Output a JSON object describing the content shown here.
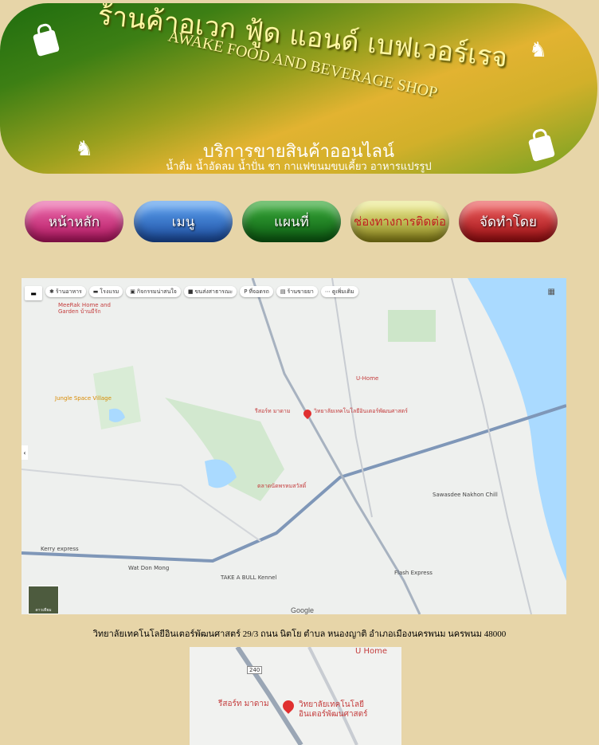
{
  "banner": {
    "title_th": "ร้านค้าอเวก ฟู้ด แอนด์ เบฟเวอร์เรจ",
    "title_en": "AWAKE FOOD AND BEVERAGE SHOP",
    "service": "บริการขายสินค้าออนไลน์",
    "products": "น้ำดื่ม น้ำอัดลม น้ำปั่น ชา กาแฟขนมขบเคี้ยว อาหารแปรรูป"
  },
  "nav": {
    "home": "หน้าหลัก",
    "menu": "เมนู",
    "map": "แผนที่",
    "contact": "ช่องทางการติดต่อ",
    "made_by": "จัดทำโดย"
  },
  "map": {
    "toolbar": [
      {
        "icon": "restaurant-icon",
        "label": "ร้านอาหาร"
      },
      {
        "icon": "hotel-icon",
        "label": "โรงแรม"
      },
      {
        "icon": "camera-icon",
        "label": "กิจกรรมน่าสนใจ"
      },
      {
        "icon": "pharmacy-icon",
        "label": "ขนส่งสาธารณะ"
      },
      {
        "icon": "parking-icon",
        "label": "ที่จอดรถ"
      },
      {
        "icon": "pharmacy-icon",
        "label": "ร้านขายยา"
      },
      {
        "icon": "more-icon",
        "label": "ดูเพิ่มเติม"
      }
    ],
    "main_label": "วิทยาลัยเทคโนโลยีอินเตอร์พัฒนศาสตร์",
    "places": [
      "MeeRak Home and Garden บ้านมีรัก",
      "Jungle Space Village",
      "รีสอร์ท มาดาม",
      "U-Home",
      "Kerry express",
      "Wat Don Mong",
      "TAKE A BULL Kennel",
      "Flash Express",
      "ตลาดนัดพรหมสวัสดิ์",
      "Sawasdee Nakhon Chill"
    ],
    "attribution": "Google",
    "satellite": "ดาวเทียม"
  },
  "address": "วิทยาลัยเทคโนโลยีอินเตอร์พัฒนศาสตร์ 29/3 ถนน นิตโย ตำบล หนองญาติ อำเภอเมืองนครพนม นครพนม 48000",
  "map2": {
    "uhome": "U Home",
    "shop": "รีสอร์ท มาดาม",
    "main_label_1": "วิทยาลัยเทคโนโลยี",
    "main_label_2": "อินเตอร์พัฒนศาสตร์",
    "road": "240"
  }
}
